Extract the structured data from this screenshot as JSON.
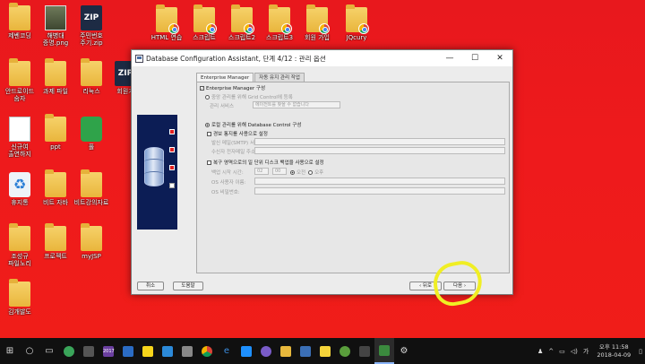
{
  "desktop": {
    "icons": [
      {
        "label": "제벤코딩",
        "kind": "folder"
      },
      {
        "label": "해병대\n증명.png",
        "kind": "photo"
      },
      {
        "label": "주민번호\n주기.zip",
        "kind": "zip"
      },
      {
        "label": "HTML 연습",
        "kind": "chrome-folder"
      },
      {
        "label": "스크립트",
        "kind": "chrome-folder"
      },
      {
        "label": "스크립트2",
        "kind": "chrome-folder"
      },
      {
        "label": "스크립트3",
        "kind": "chrome-folder"
      },
      {
        "label": "회원 가입",
        "kind": "chrome-folder"
      },
      {
        "label": "JQcury",
        "kind": "chrome-folder"
      },
      {
        "label": "안드로이드\n숨자",
        "kind": "folder"
      },
      {
        "label": "과제 파일",
        "kind": "folder"
      },
      {
        "label": "리눅스",
        "kind": "folder"
      },
      {
        "label": "회원가",
        "kind": "zip"
      },
      {
        "label": "신규여\n출연하지",
        "kind": "file"
      },
      {
        "label": "ppt",
        "kind": "folder"
      },
      {
        "label": "풀",
        "kind": "green"
      },
      {
        "label": "휴지통",
        "kind": "recycle"
      },
      {
        "label": "비트 자바",
        "kind": "folder"
      },
      {
        "label": "비트강의자료",
        "kind": "folder"
      },
      {
        "label": "조성규\n파일노리",
        "kind": "folder"
      },
      {
        "label": "프로젝트",
        "kind": "folder"
      },
      {
        "label": "myJSP",
        "kind": "folder"
      },
      {
        "label": "김개발도",
        "kind": "folder"
      }
    ]
  },
  "dialog": {
    "title": "Database Configuration Assistant, 단계 4/12 : 관리 옵션",
    "window_buttons": {
      "minimize": "—",
      "maximize": "☐",
      "close": "✕"
    },
    "tabs": [
      {
        "label": "Enterprise Manager",
        "active": true
      },
      {
        "label": "자동 유지 관리 작업",
        "active": false
      }
    ],
    "em_configure": "Enterprise Manager 구성",
    "grid_control_option": "중앙 관리를 위해 Grid Control에 등록",
    "mgmt_service_label": "관리 서비스",
    "mgmt_service_select": "에이전트를 찾을 수 없습니다",
    "db_control_option": "로컬 관리를 위해 Database Control 구성",
    "email_alert": "경보 통지를 사용으로 설정",
    "smtp_label": "발신 메일(SMTP) 서버:",
    "recipient_label": "수신자 전자메일 주소:",
    "backup_option": "복구 영역으로의 일 단위 디스크 백업을 사용으로 설정",
    "backup_time_label": "백업 시작 시간:",
    "backup_hour": "02",
    "backup_minute": "00",
    "am_label": "오전",
    "pm_label": "오후",
    "os_user_label": "OS 사용자 이름:",
    "os_password_label": "OS 비밀번호:",
    "cancel_button": "취소",
    "help_button": "도움말",
    "back_button": "뒤로",
    "next_button": "다음",
    "steps": [
      true,
      true,
      true,
      false
    ]
  },
  "taskbar": {
    "clock_time": "오후 11:58",
    "clock_date": "2018-04-09",
    "ime": "가",
    "app_badge": "2017"
  },
  "colors": {
    "desktop": "#ee1a1c",
    "highlight": "#f0ee24",
    "wizard_panel": "#0c1d55"
  }
}
